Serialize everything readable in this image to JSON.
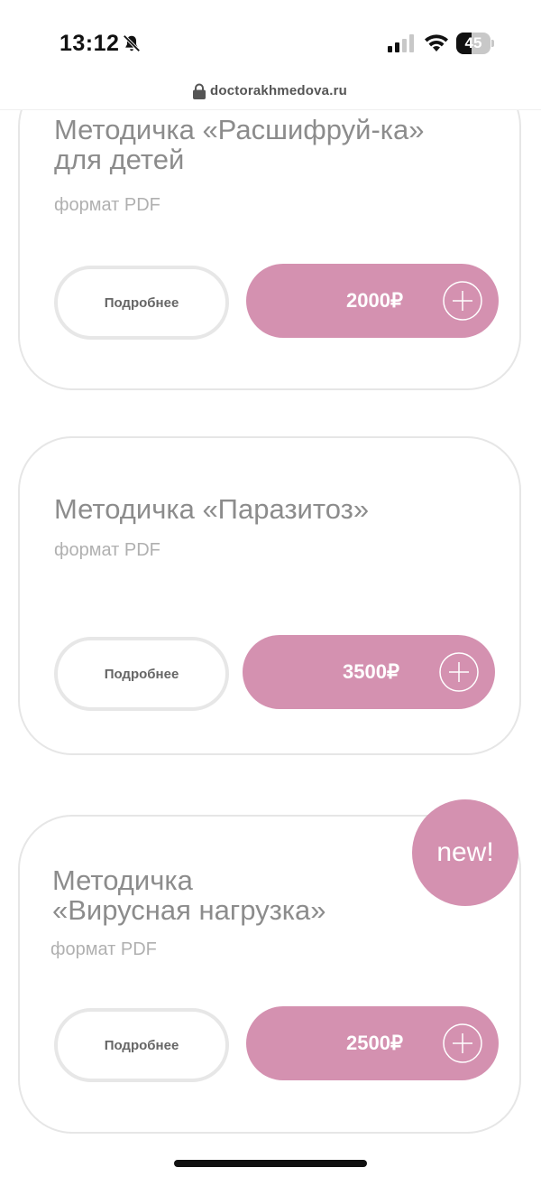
{
  "status_bar": {
    "time": "13:12",
    "battery_level": 45,
    "battery_text": "45",
    "icons": [
      "bell-slash-icon",
      "cellular-signal-icon",
      "wifi-icon",
      "battery-icon"
    ]
  },
  "browser": {
    "url": "doctorakhmedova.ru"
  },
  "colors": {
    "accent": "#d491b0",
    "border": "#e6e6e6",
    "title": "#8c8c8c",
    "muted": "#b0b0b0"
  },
  "products": [
    {
      "title_line1": "Методичка «Расшифруй-ка»",
      "title_line2": "для детей",
      "format": "формат PDF",
      "details_label": "Подробнее",
      "price": "2000₽"
    },
    {
      "title_line1": "Методичка «Паразитоз»",
      "title_line2": "",
      "format": "формат PDF",
      "details_label": "Подробнее",
      "price": "3500₽"
    },
    {
      "title_line1": "Методичка",
      "title_line2": "«Вирусная нагрузка»",
      "format": "формат PDF",
      "details_label": "Подробнее",
      "price": "2500₽",
      "badge": "new!"
    }
  ]
}
